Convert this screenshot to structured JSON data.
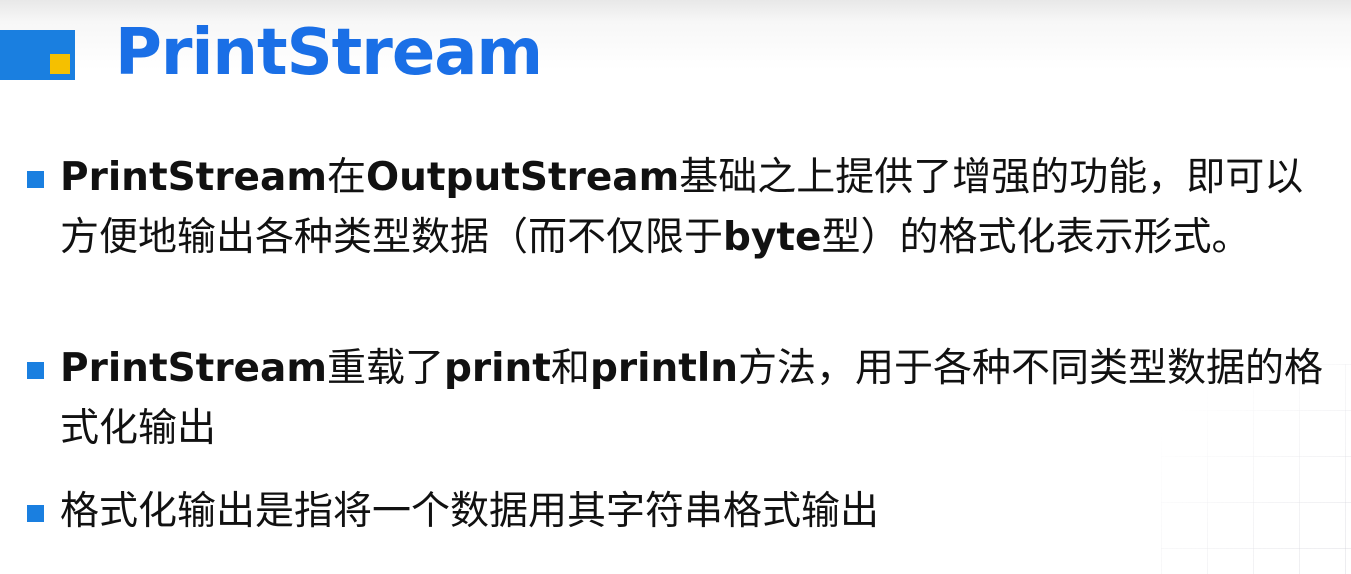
{
  "title": "PrintStream",
  "bullets": [
    {
      "segments": [
        {
          "text": "PrintStream",
          "bold": true
        },
        {
          "text": "在",
          "bold": false
        },
        {
          "text": "OutputStream",
          "bold": true
        },
        {
          "text": "基础之上提供了增强的功能，即可以方便地输出各种类型数据（而不仅限于",
          "bold": false
        },
        {
          "text": "byte",
          "bold": true
        },
        {
          "text": "型）的格式化表示形式。",
          "bold": false
        }
      ]
    },
    {
      "segments": [
        {
          "text": "PrintStream",
          "bold": true
        },
        {
          "text": "重载了",
          "bold": false
        },
        {
          "text": "print",
          "bold": true
        },
        {
          "text": "和",
          "bold": false
        },
        {
          "text": "println",
          "bold": true
        },
        {
          "text": "方法，用于各种不同类型数据的格式化输出",
          "bold": false
        }
      ]
    },
    {
      "segments": [
        {
          "text": "格式化输出是指将一个数据用其字符串格式输出",
          "bold": false
        }
      ]
    }
  ],
  "colors": {
    "accent_blue": "#1a7fe0",
    "accent_yellow": "#f5c000",
    "title_blue": "#1a6fe6",
    "text": "#111111"
  }
}
